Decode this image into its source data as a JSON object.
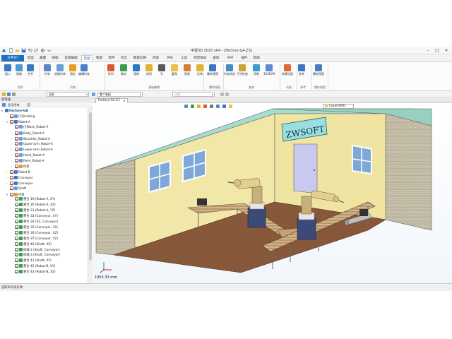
{
  "window": {
    "title": "中望3D 2020 x64 - [Factory-GA.Z3]"
  },
  "tabs": [
    "文件(F)",
    "造型",
    "曲面",
    "线框",
    "直接编辑",
    "装配",
    "钣金",
    "焊件",
    "点云",
    "数据交换",
    "修复",
    "PMI",
    "工具",
    "视觉样式",
    "查询",
    "APP",
    "插件",
    "帮助"
  ],
  "active_tab": "装配",
  "ribbon": {
    "buttons": [
      "插入",
      "镜像",
      "合并",
      "约束",
      "机械约束",
      "固定",
      "编辑约束",
      "阵列",
      "移动",
      "镜像",
      "剖切",
      "孔",
      "圆角",
      "倒角",
      "拉伸",
      "爆炸视图",
      "约束状态",
      "干涉检查",
      "间隙",
      "3D BOM",
      "新建动画",
      "参考",
      "爆炸视图"
    ],
    "groups": [
      "组件",
      "约束",
      "基础编辑",
      "爆炸视图",
      "查询",
      "动画",
      "参考",
      "爆炸视图"
    ]
  },
  "toolbar": {
    "filter_value": "全部",
    "mode_value": "整个装配",
    "combo3_placeholder": "过滤"
  },
  "manager": {
    "title": "管理器",
    "tools_label": "显示所有"
  },
  "tree": [
    {
      "label": "Factory-GA",
      "level": 0,
      "bold": true,
      "arrow": "▾",
      "icon": "assembly"
    },
    {
      "label": "(F)Building",
      "level": 1,
      "arrow": "›",
      "check": true,
      "icon": "part"
    },
    {
      "label": "Robot-A",
      "level": 1,
      "arrow": "▾",
      "check": true,
      "icon": "assembly"
    },
    {
      "label": "(F)Base_Robot-A",
      "level": 2,
      "arrow": "",
      "check": true,
      "icon": "part"
    },
    {
      "label": "Body_Robot-A",
      "level": 2,
      "arrow": "›",
      "check": true,
      "icon": "part"
    },
    {
      "label": "Shoulder_Robot-A",
      "level": 2,
      "arrow": "›",
      "check": true,
      "icon": "part"
    },
    {
      "label": "Upper-arm_Robot-A",
      "level": 2,
      "arrow": "›",
      "check": true,
      "icon": "part"
    },
    {
      "label": "Lower-arm_Robot-A",
      "level": 2,
      "arrow": "›",
      "check": true,
      "icon": "part"
    },
    {
      "label": "Hand_Robot-A",
      "level": 2,
      "arrow": "›",
      "check": true,
      "icon": "part"
    },
    {
      "label": "Palm_Robot-A",
      "level": 2,
      "arrow": "›",
      "check": true,
      "icon": "part"
    },
    {
      "label": "约束",
      "level": 2,
      "arrow": "›",
      "check": true,
      "icon": "constraint"
    },
    {
      "label": "Robot-B",
      "level": 1,
      "arrow": "›",
      "check": true,
      "icon": "assembly"
    },
    {
      "label": "Conveyor",
      "level": 1,
      "arrow": "›",
      "check": true,
      "icon": "assembly"
    },
    {
      "label": "Conveyor",
      "level": 1,
      "arrow": "›",
      "check": true,
      "icon": "assembly"
    },
    {
      "label": "Shaft",
      "level": 1,
      "arrow": "",
      "check": true,
      "icon": "part"
    },
    {
      "label": "约束",
      "level": 1,
      "arrow": "▾",
      "check": true,
      "icon": "constraint"
    },
    {
      "label": "重合 19 (Robot-A, XY)",
      "level": 2,
      "arrow": "",
      "check": true,
      "green": true,
      "icon": "mate"
    },
    {
      "label": "重合 20 (Robot-A, XZ)",
      "level": 2,
      "arrow": "",
      "check": true,
      "green": true,
      "icon": "mate"
    },
    {
      "label": "重合 21 (Robot-A, YZ)",
      "level": 2,
      "arrow": "",
      "check": true,
      "green": true,
      "icon": "mate"
    },
    {
      "label": "重合 32 (Conveyor, XY)",
      "level": 2,
      "arrow": "",
      "check": true,
      "green": true,
      "icon": "mate"
    },
    {
      "label": "重合 34 (XZ, Conveyor)",
      "level": 2,
      "arrow": "",
      "check": true,
      "green": true,
      "icon": "mate"
    },
    {
      "label": "重合 35 (Conveyor, YZ)",
      "level": 2,
      "arrow": "",
      "check": true,
      "green": true,
      "icon": "mate"
    },
    {
      "label": "重合 36 (Conveyor, XZ)",
      "level": 2,
      "arrow": "",
      "check": true,
      "green": true,
      "icon": "mate"
    },
    {
      "label": "重合 37 (Conveyor, YZ)",
      "level": 2,
      "arrow": "",
      "check": true,
      "green": true,
      "icon": "mate"
    },
    {
      "label": "重合 40 (Shaft, XZ)",
      "level": 2,
      "arrow": "",
      "check": true,
      "green": true,
      "icon": "mate"
    },
    {
      "label": "同轴 2 (Shaft, Conveyor)",
      "level": 2,
      "arrow": "",
      "check": true,
      "green": true,
      "icon": "mate"
    },
    {
      "label": "同轴 3 (Shaft, Conveyor)",
      "level": 2,
      "arrow": "",
      "check": true,
      "green": true,
      "icon": "mate"
    },
    {
      "label": "重合 41 (Shaft, XY)",
      "level": 2,
      "arrow": "",
      "check": true,
      "green": true,
      "icon": "mate"
    },
    {
      "label": "重合 42 (Robot-B, XY)",
      "level": 2,
      "arrow": "",
      "check": true,
      "green": true,
      "icon": "mate"
    },
    {
      "label": "重合 43 (Robot-B, XZ)",
      "level": 2,
      "arrow": "",
      "check": true,
      "green": true,
      "icon": "mate"
    }
  ],
  "document_tab": "Factory-GA.Z3",
  "layer": "Layer0000",
  "viewport": {
    "sign_text": "ZWSOFT",
    "scale_text": "1953.33 mm"
  },
  "status": {
    "text": "选取命令或实体"
  },
  "colors": {
    "accent": "#1e6fc0",
    "wall": "#f1e7a8",
    "roof": "#a9dccf",
    "brick": "#c9c2ad",
    "floor": "#8a5a3c"
  }
}
